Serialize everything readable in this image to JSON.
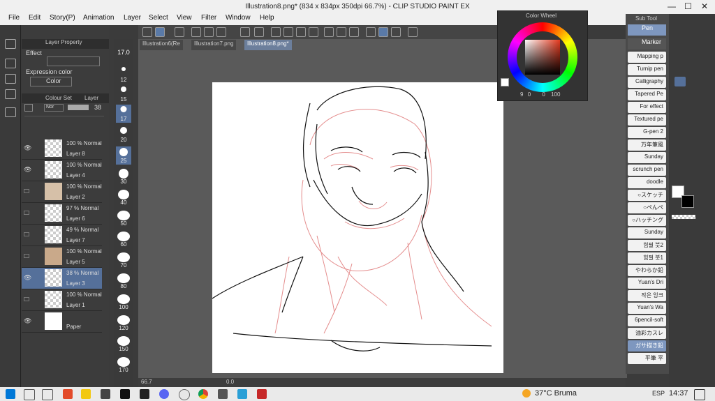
{
  "window": {
    "title": "Illustration8.png* (834 x 834px 350dpi 66.7%) - CLIP STUDIO PAINT EX",
    "minimize": "—",
    "maximize": "☐",
    "close": "✕"
  },
  "menu": [
    "File",
    "Edit",
    "Story(P)",
    "Animation",
    "Layer",
    "Select",
    "View",
    "Filter",
    "Window",
    "Help"
  ],
  "tabs": [
    "Illustration6(Re",
    "Illustration7.png",
    "Illustration8.png*"
  ],
  "layer_property": {
    "title": "Layer Property",
    "effect": "Effect",
    "expression_color": "Expression color",
    "color_value": "Color"
  },
  "layer_panel": {
    "tab1": "Colour Set",
    "tab2": "Layer",
    "blend": "Nor",
    "opacity": "38"
  },
  "layers": [
    {
      "opacity": "100 % Normal",
      "name": "Layer 8",
      "visible": true
    },
    {
      "opacity": "100 % Normal",
      "name": "Layer 4",
      "visible": true
    },
    {
      "opacity": "100 % Normal",
      "name": "Layer 2",
      "visible": false
    },
    {
      "opacity": "97 % Normal",
      "name": "Layer 6",
      "visible": false
    },
    {
      "opacity": "49 % Normal",
      "name": "Layer 7",
      "visible": false
    },
    {
      "opacity": "100 % Normal",
      "name": "Layer 5",
      "visible": false
    },
    {
      "opacity": "38 % Normal",
      "name": "Layer 3",
      "visible": true
    },
    {
      "opacity": "100 % Normal",
      "name": "Layer 1",
      "visible": false
    },
    {
      "opacity": "",
      "name": "Paper",
      "visible": true
    }
  ],
  "brush_sizes": [
    "17.0",
    "12",
    "15",
    "17",
    "20",
    "25",
    "30",
    "40",
    "50",
    "60",
    "70",
    "80",
    "100",
    "120",
    "150",
    "170"
  ],
  "status": {
    "zoom": "66.7",
    "rotation": "0.0"
  },
  "color_wheel": {
    "title": "Color Wheel",
    "values": [
      "9",
      "0",
      "0",
      "100"
    ]
  },
  "sub_tool": {
    "title": "Sub Tool",
    "pen": "Pen",
    "marker": "Marker",
    "brushes": [
      "Mapping p",
      "Turnip pen",
      "Calligraphy",
      "Tapered Pe",
      "For effect",
      "Textured pe",
      "G-pen 2",
      "万年筆風",
      "Sunday",
      "scrunch pen",
      "doodle",
      "○スケッチ",
      "○ぺんぺ",
      "○ハッチング",
      "Sunday",
      "힘필 붓2",
      "힘필 붓1",
      "やわらか鉛",
      "Yuan's Dri",
      "작은 잉크",
      "Yuan's Wa",
      "6pencil-soft",
      "油彩カスレ",
      "ガサ描き鉛",
      "平筆 平"
    ]
  },
  "taskbar": {
    "weather": "37°C Bruma",
    "lang": "ESP",
    "time": "14:37"
  },
  "colors": {
    "accent": "#55709a",
    "paper": "#ffffff",
    "sketch_black": "#111111",
    "sketch_red": "#e07a7a"
  }
}
